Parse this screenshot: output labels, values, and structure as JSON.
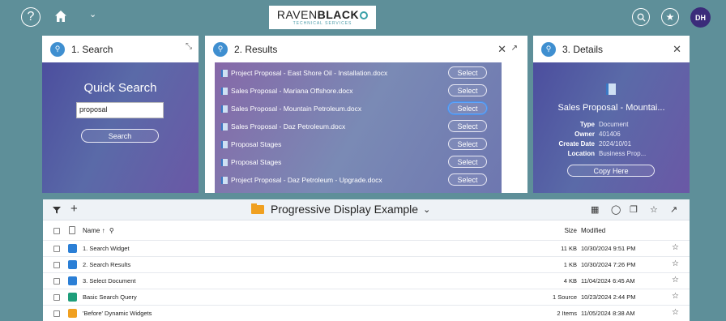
{
  "topbar": {
    "help_glyph": "?",
    "home_icon": "home-icon",
    "chevron": "⌄",
    "logo_main_light": "RAVEN",
    "logo_main_bold": "BLACK",
    "logo_sub": "TECHNICAL SERVICES",
    "avatar_initials": "DH"
  },
  "search_panel": {
    "title": "1. Search",
    "heading": "Quick Search",
    "input_value": "proposal",
    "button_label": "Search"
  },
  "results_panel": {
    "title": "2. Results",
    "select_label": "Select",
    "rows": [
      {
        "name": "Project Proposal - East Shore Oil - Installation.docx"
      },
      {
        "name": "Sales Proposal - Mariana Offshore.docx"
      },
      {
        "name": "Sales Proposal - Mountain Petroleum.docx",
        "active": true
      },
      {
        "name": "Sales Proposal - Daz Petroleum.docx"
      },
      {
        "name": "Proposal Stages"
      },
      {
        "name": "Proposal Stages"
      },
      {
        "name": "Project Proposal - Daz Petroleum - Upgrade.docx"
      }
    ]
  },
  "details_panel": {
    "title": "3. Details",
    "doc_title": "Sales Proposal - Mountai...",
    "fields": [
      {
        "key": "Type",
        "value": "Document"
      },
      {
        "key": "Owner",
        "value": "401406"
      },
      {
        "key": "Create Date",
        "value": "2024/10/01"
      },
      {
        "key": "Location",
        "value": "Business Prop..."
      }
    ],
    "button_label": "Copy Here"
  },
  "browser": {
    "folder_title": "Progressive Display Example",
    "col_name": "Name",
    "col_size": "Size",
    "col_modified": "Modified",
    "rows": [
      {
        "name": "1. Search Widget",
        "size": "11 KB",
        "modified": "10/30/2024 9:51 PM",
        "icon": "widget-icon",
        "color": "#2b7fd6"
      },
      {
        "name": "2. Search Results",
        "size": "1 KB",
        "modified": "10/30/2024 7:26 PM",
        "icon": "widget-icon",
        "color": "#2b7fd6"
      },
      {
        "name": "3. Select Document",
        "size": "4 KB",
        "modified": "11/04/2024 6:45 AM",
        "icon": "widget-icon",
        "color": "#2b7fd6"
      },
      {
        "name": "Basic Search Query",
        "size": "1 Source",
        "modified": "10/23/2024 2:44 PM",
        "icon": "search-query-icon",
        "color": "#1e9e7a"
      },
      {
        "name": "'Before' Dynamic Widgets",
        "size": "2 Items",
        "modified": "11/05/2024 8:38 AM",
        "icon": "folder-icon",
        "color": "#f0a020"
      }
    ]
  },
  "colors": {
    "background": "#5e8f99",
    "accent": "#3f8fd0",
    "avatar": "#3b2c7a"
  }
}
